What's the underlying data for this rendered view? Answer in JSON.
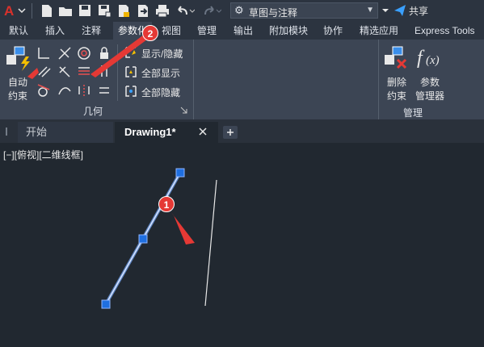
{
  "quick_access": {
    "workspace": "草图与注释",
    "share": "共享"
  },
  "ribbon_tabs": [
    "默认",
    "插入",
    "注释",
    "参数化",
    "视图",
    "管理",
    "输出",
    "附加模块",
    "协作",
    "精选应用",
    "Express Tools"
  ],
  "active_tab": "参数化",
  "ribbon": {
    "auto_constraint_line1": "自动",
    "auto_constraint_line2": "约束",
    "show_hide": "显示/隐藏",
    "show_all": "全部显示",
    "hide_all": "全部隐藏",
    "geometry_panel": "几何",
    "delete_constraint_line1": "删除",
    "delete_constraint_line2": "约束",
    "param_manager_line1": "参数",
    "param_manager_line2": "管理器",
    "manage_panel": "管理"
  },
  "doc_tabs": {
    "start": "开始",
    "drawing": "Drawing1*"
  },
  "viewport_label": "[−][俯视][二维线框]",
  "annotations": {
    "badge1": "1",
    "badge2": "2"
  },
  "colors": {
    "accent_red": "#e53935",
    "grip_blue": "#1f6fe0",
    "background": "#212830"
  }
}
